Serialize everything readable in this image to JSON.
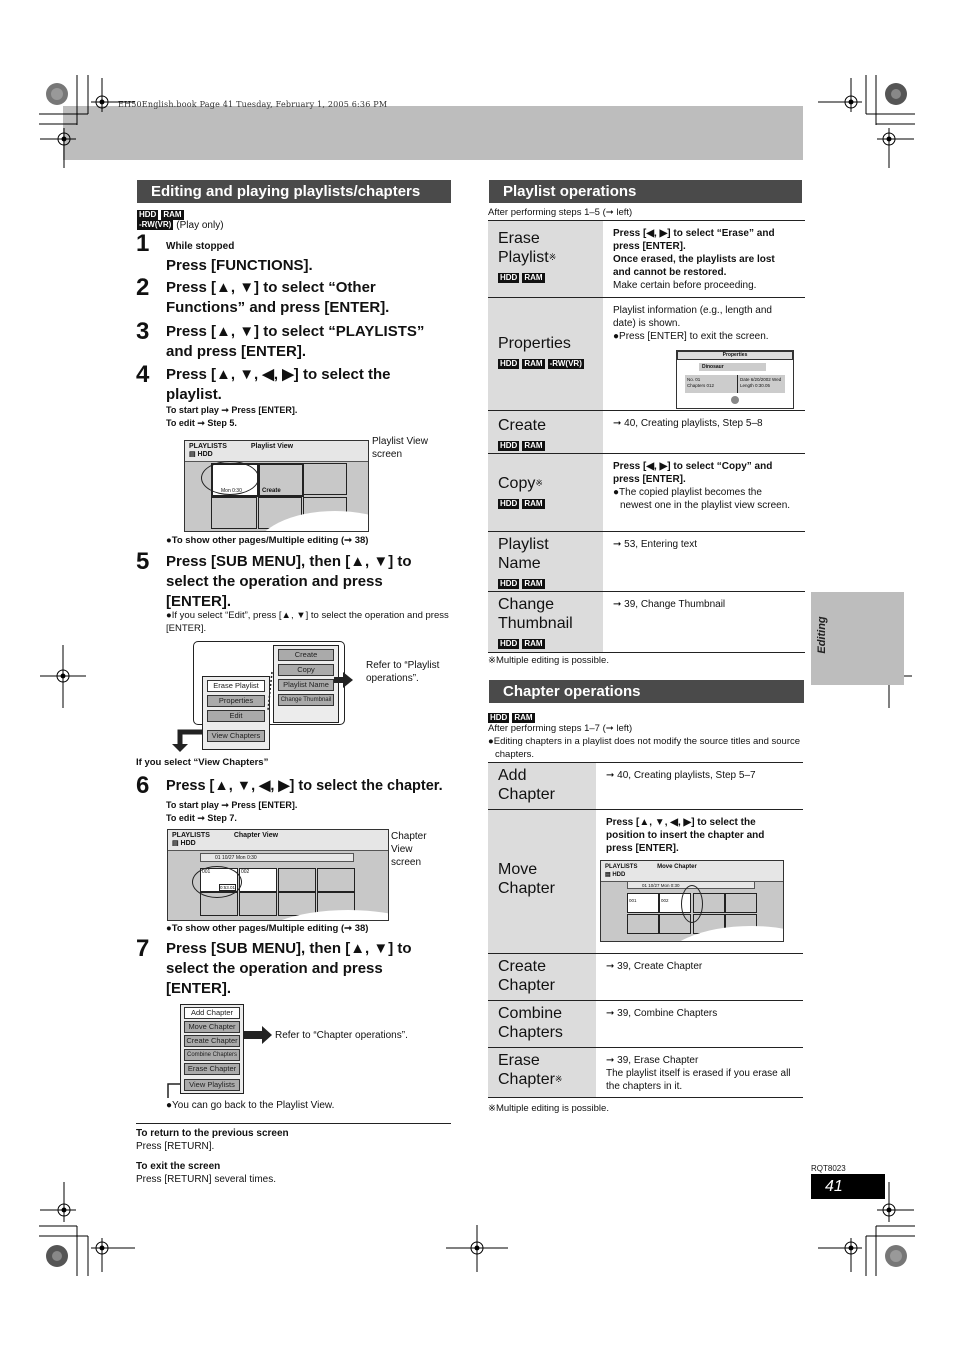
{
  "book_line": "EH50English.book  Page 41  Tuesday, February 1, 2005  6:36 PM",
  "side_tab": "Editing",
  "page_code": "RQT8023",
  "page_number": "41",
  "left": {
    "section_title": "Editing and playing playlists/chapters",
    "badges": [
      "HDD",
      "RAM"
    ],
    "badge_rw": "-RW(VR)",
    "play_only": "(Play only)",
    "steps": [
      {
        "num": "1",
        "pre": "While stopped",
        "text": "Press [FUNCTIONS]."
      },
      {
        "num": "2",
        "text": "Press [▲, ▼] to select “Other Functions” and press [ENTER]."
      },
      {
        "num": "3",
        "text": "Press [▲, ▼] to select “PLAYLISTS” and press [ENTER]."
      },
      {
        "num": "4",
        "text": "Press [▲, ▼, ◀, ▶] to select the playlist.",
        "sub1": "To start play ➞ Press [ENTER].",
        "sub2": "To edit ➞ Step 5."
      },
      {
        "num": "5",
        "text": "Press [SUB MENU], then [▲, ▼] to select the operation and press [ENTER].",
        "note": "●If you select “Edit”, press [▲, ▼] to select the operation and press [ENTER]."
      },
      {
        "num": "6",
        "text": "Press [▲, ▼, ◀, ▶] to select the chapter.",
        "sub1": "To start play ➞ Press [ENTER].",
        "sub2": "To edit ➞ Step 7."
      },
      {
        "num": "7",
        "text": "Press [SUB MENU], then [▲, ▼] to select the operation and press [ENTER]."
      }
    ],
    "playlist_screen": {
      "title1": "PLAYLISTS",
      "title2": "Playlist View",
      "drive": "▤ HDD",
      "thumb_date": "Mon 0:30",
      "create": "Create",
      "caption": "Playlist View screen"
    },
    "multi_note": "●To show other pages/Multiple editing (➞ 38)",
    "submenu": {
      "left_items": [
        "Erase Playlist",
        "Properties",
        "Edit",
        "View Chapters"
      ],
      "right_items": [
        "Create",
        "Copy",
        "Playlist Name",
        "Change Thumbnail"
      ],
      "refer": "Refer to “Playlist operations”.",
      "if_view_chapters": "If you select “View Chapters”"
    },
    "chapter_screen": {
      "title1": "PLAYLISTS",
      "title2": "Chapter View",
      "drive": "▤ HDD",
      "info": "01 10/27 Mon 0:30",
      "ch1": "001",
      "ch2": "002",
      "time": "0:53.01",
      "caption": "Chapter View screen"
    },
    "multi_note2": "●To show other pages/Multiple editing (➞ 38)",
    "chapter_menu": {
      "items": [
        "Add Chapter",
        "Move Chapter",
        "Create Chapter",
        "Combine Chapters",
        "Erase Chapter",
        "View Playlists"
      ],
      "refer": "Refer to “Chapter operations”.",
      "back_note": "●You can go back to the Playlist View."
    },
    "return_title": "To return to the previous screen",
    "return_text": "Press [RETURN].",
    "exit_title": "To exit the screen",
    "exit_text": "Press [RETURN] several times."
  },
  "playlist_ops": {
    "title": "Playlist operations",
    "intro": "After performing steps 1–5 (➞ left)",
    "rows": [
      {
        "name": "Erase Playlist",
        "ast": "※",
        "badges": [
          "HDD",
          "RAM"
        ],
        "bold1": "Press [◀, ▶] to select “Erase” and press [ENTER].",
        "bold2": "Once erased, the playlists are lost and cannot be restored.",
        "text": "Make certain before proceeding."
      },
      {
        "name": "Properties",
        "badges": [
          "HDD",
          "RAM",
          "-RW(VR)"
        ],
        "text": "Playlist information (e.g., length and date) is shown.",
        "bullet": "●Press [ENTER] to exit the screen.",
        "props": {
          "header": "Properties",
          "title": "Dinosaur",
          "k1": "No.",
          "v1": "01",
          "k2": "Chapters",
          "v2": "012",
          "k3": "Date",
          "v3": "6/20/2002 Wed",
          "k4": "Length",
          "v4": "0:30.05"
        }
      },
      {
        "name": "Create",
        "badges": [
          "HDD",
          "RAM"
        ],
        "text": "➞ 40, Creating playlists, Step 5–8"
      },
      {
        "name": "Copy",
        "ast": "※",
        "badges": [
          "HDD",
          "RAM"
        ],
        "bold1": "Press [◀, ▶] to select “Copy” and press [ENTER].",
        "bullet": "●The copied playlist becomes the newest one in the playlist view screen."
      },
      {
        "name": "Playlist Name",
        "badges": [
          "HDD",
          "RAM"
        ],
        "text": "➞ 53, Entering text"
      },
      {
        "name": "Change Thumbnail",
        "badges": [
          "HDD",
          "RAM"
        ],
        "text": "➞ 39, Change Thumbnail"
      }
    ],
    "footnote": "※Multiple editing is possible."
  },
  "chapter_ops": {
    "title": "Chapter operations",
    "badges": [
      "HDD",
      "RAM"
    ],
    "intro": "After performing steps 1–7 (➞ left)",
    "note": "●Editing chapters in a playlist does not modify the source titles and source chapters.",
    "rows": [
      {
        "name": "Add Chapter",
        "text": "➞ 40, Creating playlists, Step 5–7"
      },
      {
        "name": "Move Chapter",
        "bold1": "Press [▲, ▼, ◀, ▶] to select the position to insert the chapter and press [ENTER].",
        "screen": {
          "title1": "PLAYLISTS",
          "title2": "Move Chapter",
          "drive": "▤ HDD",
          "info": "01 10/27 Mon 0:30",
          "ch1": "001",
          "ch2": "002"
        }
      },
      {
        "name": "Create Chapter",
        "text": "➞ 39, Create Chapter"
      },
      {
        "name": "Combine Chapters",
        "text": "➞ 39, Combine Chapters"
      },
      {
        "name": "Erase Chapter",
        "ast": "※",
        "text": "➞ 39, Erase Chapter",
        "text2": "The playlist itself is erased if you erase all the chapters in it."
      }
    ],
    "footnote": "※Multiple editing is possible."
  }
}
